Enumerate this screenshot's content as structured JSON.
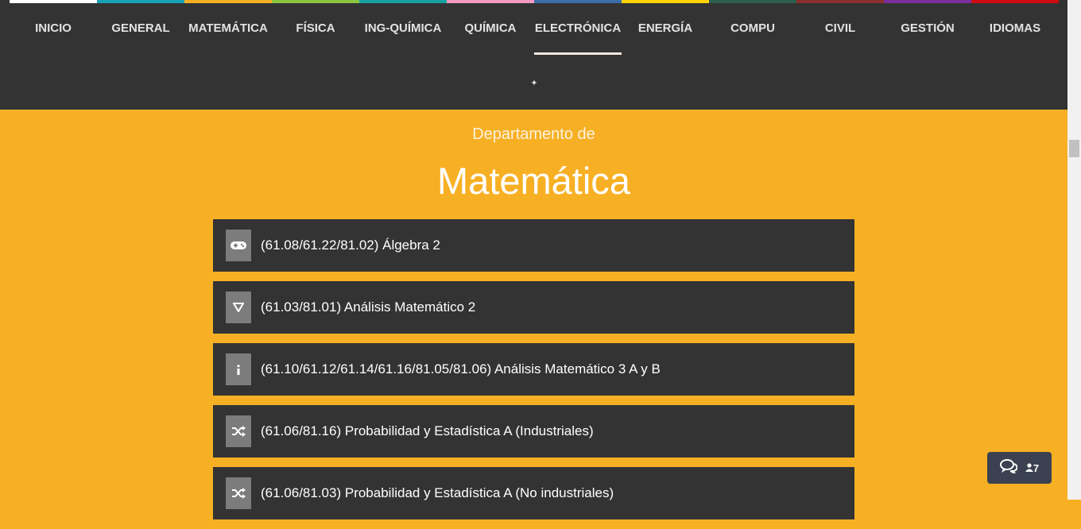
{
  "nav": {
    "items": [
      {
        "label": "INICIO",
        "color": "#ffffff"
      },
      {
        "label": "GENERAL",
        "color": "#17a2b8"
      },
      {
        "label": "MATEMÁTICA",
        "color": "#f7b024"
      },
      {
        "label": "FÍSICA",
        "color": "#8cc63f"
      },
      {
        "label": "ING-QUÍMICA",
        "color": "#17a2a2"
      },
      {
        "label": "QUÍMICA",
        "color": "#f49ac1"
      },
      {
        "label": "ELECTRÓNICA",
        "color": "#3b6ea8"
      },
      {
        "label": "ENERGÍA",
        "color": "#ffd200"
      },
      {
        "label": "COMPU",
        "color": "#2c5e4e"
      },
      {
        "label": "CIVIL",
        "color": "#8b2e2e"
      },
      {
        "label": "GESTIÓN",
        "color": "#7b2f9c"
      },
      {
        "label": "IDIOMAS",
        "color": "#d10a11"
      }
    ],
    "active_index": 6,
    "toggle_symbol": "✦"
  },
  "header": {
    "subtitle": "Departamento de",
    "title": "Matemática"
  },
  "courses": [
    {
      "label": "(61.08/61.22/81.02) Álgebra 2",
      "icon": "gamepad-icon"
    },
    {
      "label": "(61.03/81.01) Análisis Matemático 2",
      "icon": "nabla-icon"
    },
    {
      "label": "(61.10/61.12/61.14/61.16/81.05/81.06) Análisis Matemático 3 A y B",
      "icon": "info-icon"
    },
    {
      "label": "(61.06/81.16) Probabilidad y Estadística A (Industriales)",
      "icon": "shuffle-icon"
    },
    {
      "label": "(61.06/81.03) Probabilidad y Estadística A (No industriales)",
      "icon": "shuffle-icon"
    }
  ],
  "chat": {
    "icon": "comments-icon",
    "user_icon": "user-icon",
    "online_count": "7"
  },
  "colors": {
    "background": "#f7b024",
    "navbar": "#333333",
    "card": "#333333",
    "icon_box": "#7c7c7c"
  }
}
